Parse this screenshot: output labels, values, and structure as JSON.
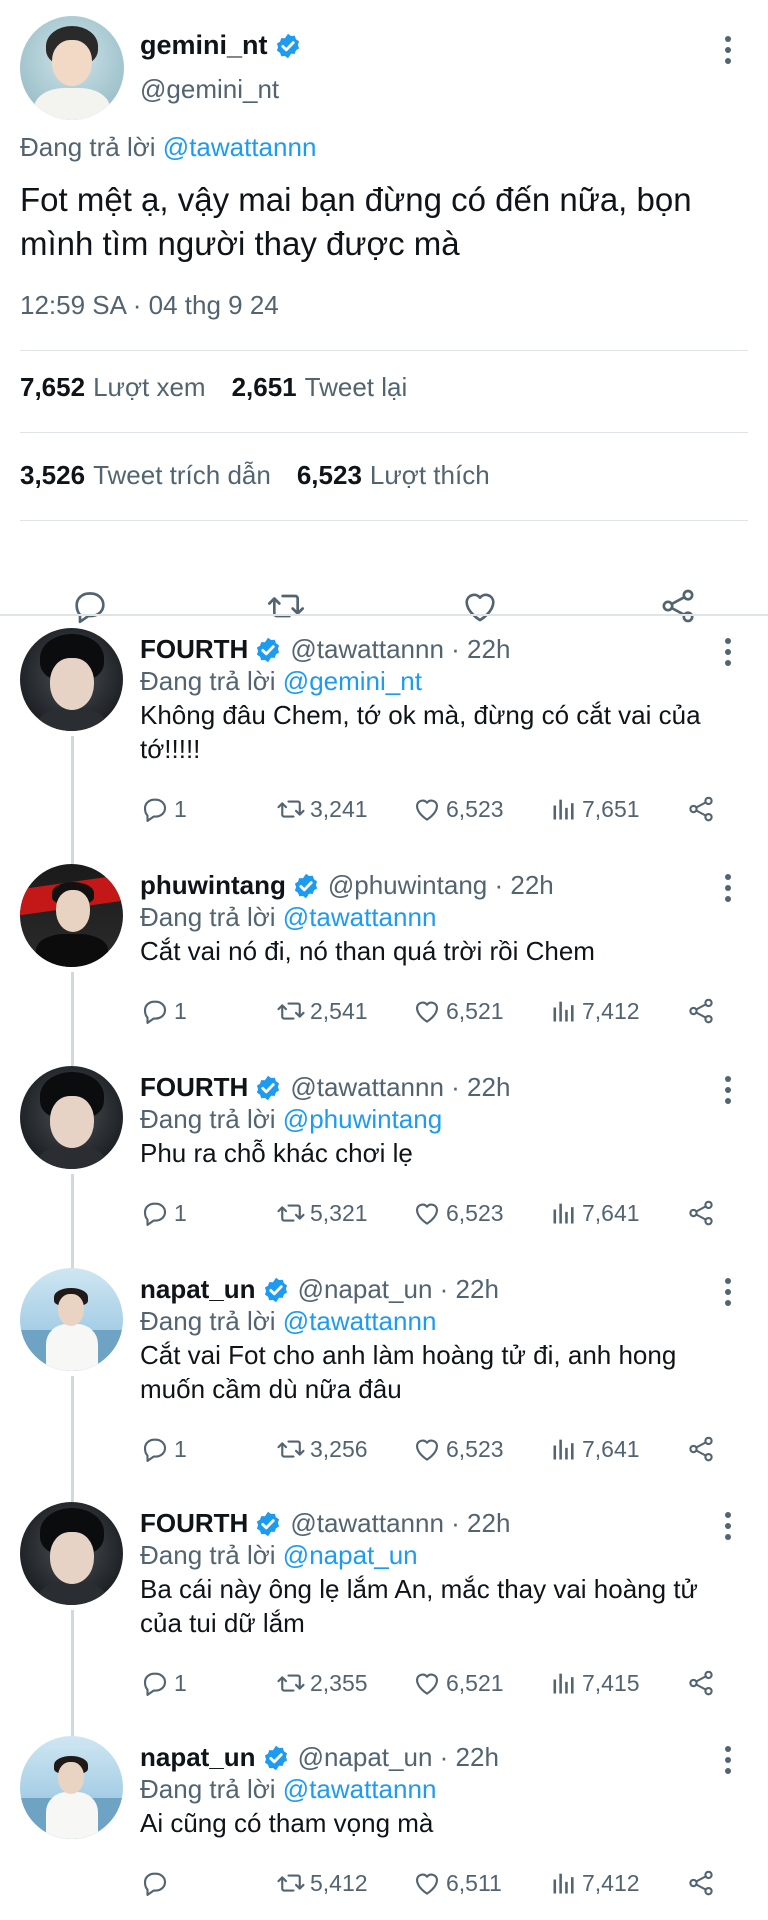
{
  "main": {
    "name": "gemini_nt",
    "handle": "@gemini_nt",
    "reply_prefix": "Đang trả lời",
    "reply_to": "@tawattannn",
    "text": "Fot mệt ạ, vậy mai bạn đừng có đến nữa, bọn mình tìm người thay được mà",
    "timestamp": "12:59 SA · 04 thg 9 24",
    "views_count": "7,652",
    "views_label": "Lượt xem",
    "retweets_count": "2,651",
    "retweets_label": "Tweet lại",
    "quotes_count": "3,526",
    "quotes_label": "Tweet trích dẫn",
    "likes_count": "6,523",
    "likes_label": "Lượt thích"
  },
  "colors": {
    "accent": "#1d9bf0",
    "secondary_text": "#536471",
    "primary_text": "#0f1419",
    "divider": "#dfe4e8"
  },
  "icons": {
    "verified": "verified-badge-icon",
    "reply": "reply-icon",
    "retweet": "retweet-icon",
    "like": "heart-icon",
    "views": "views-bar-icon",
    "share": "share-icon",
    "more": "more-vertical-icon"
  },
  "replies": [
    {
      "name": "FOURTH",
      "handle": "@tawattannn · 22h",
      "reply_prefix": "Đang trả lời",
      "reply_to": "@gemini_nt",
      "text": "Không đâu Chem, tớ ok mà, đừng có cắt vai của tớ!!!!!",
      "replies": "1",
      "retweets": "3,241",
      "likes": "6,523",
      "views": "7,651"
    },
    {
      "name": "phuwintang",
      "handle": "@phuwintang · 22h",
      "reply_prefix": "Đang trả lời",
      "reply_to": "@tawattannn",
      "text": "Cắt vai nó đi, nó than quá trời rồi Chem",
      "replies": "1",
      "retweets": "2,541",
      "likes": "6,521",
      "views": "7,412"
    },
    {
      "name": "FOURTH",
      "handle": "@tawattannn · 22h",
      "reply_prefix": "Đang trả lời",
      "reply_to": "@phuwintang",
      "text": "Phu ra chỗ khác chơi lẹ",
      "replies": "1",
      "retweets": "5,321",
      "likes": "6,523",
      "views": "7,641"
    },
    {
      "name": "napat_un",
      "handle": "@napat_un · 22h",
      "reply_prefix": "Đang trả lời",
      "reply_to": "@tawattannn",
      "text": "Cắt vai Fot cho anh làm hoàng tử đi, anh hong muốn cầm dù nữa đâu",
      "replies": "1",
      "retweets": "3,256",
      "likes": "6,523",
      "views": "7,641"
    },
    {
      "name": "FOURTH",
      "handle": "@tawattannn · 22h",
      "reply_prefix": "Đang trả lời",
      "reply_to": "@napat_un",
      "text": "Ba cái này ông lẹ lắm An, mắc thay vai hoàng tử của tui dữ lắm",
      "replies": "1",
      "retweets": "2,355",
      "likes": "6,521",
      "views": "7,415"
    },
    {
      "name": "napat_un",
      "handle": "@napat_un · 22h",
      "reply_prefix": "Đang trả lời",
      "reply_to": "@tawattannn",
      "text": "Ai cũng có tham vọng mà",
      "replies": "",
      "retweets": "5,412",
      "likes": "6,511",
      "views": "7,412"
    }
  ]
}
